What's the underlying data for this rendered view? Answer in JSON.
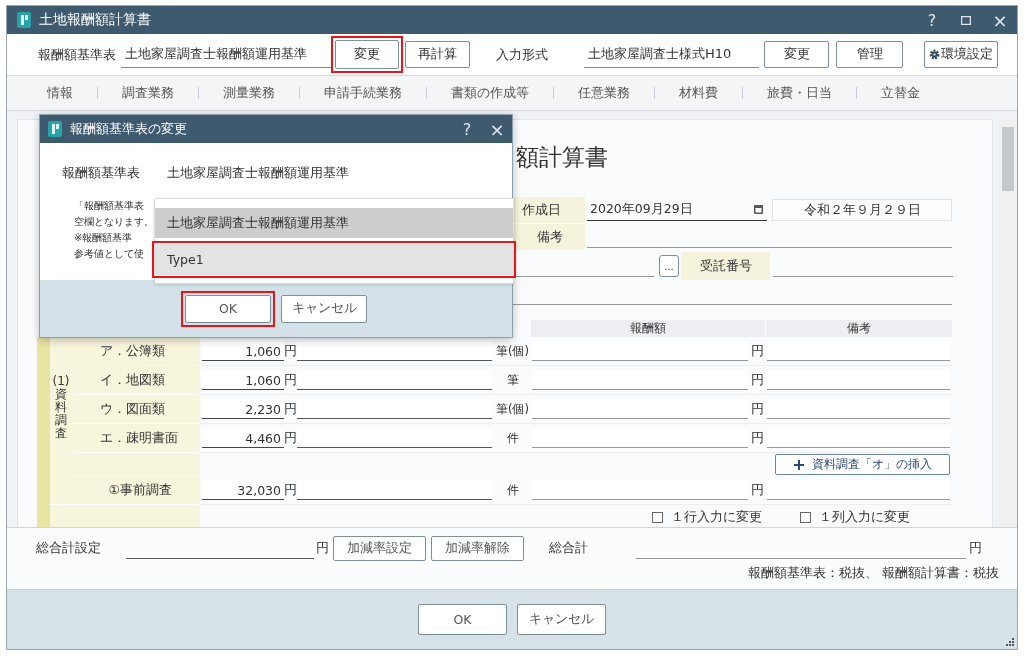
{
  "window": {
    "title": "土地報酬額計算書",
    "help": "?",
    "close": "×"
  },
  "toolbar": {
    "fee_table_label": "報酬額基準表",
    "fee_table_value": "土地家屋調査士報酬額運用基準",
    "fee_buttons": [
      {
        "label": "変更",
        "highlighted": true
      },
      {
        "label": "再計算",
        "highlighted": false
      }
    ],
    "format_label": "入力形式",
    "format_value": "土地家屋調査士様式H10",
    "format_buttons": [
      {
        "label": "変更",
        "highlighted": false
      },
      {
        "label": "管理",
        "highlighted": false
      }
    ],
    "settings_button": "環境設定"
  },
  "tabs": [
    {
      "label": "情報"
    },
    {
      "label": "調査業務"
    },
    {
      "label": "測量業務"
    },
    {
      "label": "申請手続業務"
    },
    {
      "label": "書類の作成等"
    },
    {
      "label": "任意業務"
    },
    {
      "label": "材料費"
    },
    {
      "label": "旅費・日当"
    },
    {
      "label": "立替金"
    }
  ],
  "document": {
    "title": "額計算書",
    "created_label": "作成日",
    "created_date": "2020年09月29日",
    "era_date": "令和２年９月２９日",
    "remarks_label": "備考",
    "browse_button": "...",
    "order_no_label": "受託番号",
    "table_headers": [
      "報酬額",
      "備考"
    ],
    "section_number": "(1)",
    "section_label": "資料調査",
    "rows": [
      {
        "label": "ア．公簿類",
        "amount": "1,060",
        "yen": "円",
        "unit": "筆(個)",
        "reward_yen": "円"
      },
      {
        "label": "イ．地図類",
        "amount": "1,060",
        "yen": "円",
        "unit": "筆",
        "reward_yen": "円"
      },
      {
        "label": "ウ．図面類",
        "amount": "2,230",
        "yen": "円",
        "unit": "筆(個)",
        "reward_yen": "円"
      },
      {
        "label": "エ．疎明書面",
        "amount": "4,460",
        "yen": "円",
        "unit": "件",
        "reward_yen": "円"
      }
    ],
    "insert_button": "資料調査「オ」の挿入",
    "pre_survey": {
      "label": "①事前調査",
      "amount": "32,030",
      "yen": "円",
      "unit": "件",
      "reward_yen": "円"
    },
    "checkboxes": [
      {
        "label": "１行入力に変更",
        "checked": false
      },
      {
        "label": "１列入力に変更",
        "checked": false
      }
    ]
  },
  "footer": {
    "total_setting_label": "総合計設定",
    "total_setting_yen": "円",
    "buttons": [
      "加減率設定",
      "加減率解除"
    ],
    "total_label": "総合計",
    "total_yen": "円",
    "note": "報酬額基準表：税抜、 報酬額計算書：税抜"
  },
  "bottom_buttons": [
    "OK",
    "キャンセル"
  ],
  "dialog": {
    "title": "報酬額基準表の変更",
    "help": "?",
    "close": "×",
    "field_label": "報酬額基準表",
    "field_value": "土地家屋調査士報酬額運用基準",
    "notes": [
      "「報酬額基準表",
      "空欄となります。",
      "※報酬額基準",
      "参考値として使"
    ],
    "options": [
      {
        "label": "土地家屋調査士報酬額運用基準",
        "selected": true,
        "highlighted": false
      },
      {
        "label": "Type1",
        "selected": false,
        "highlighted": true
      }
    ],
    "buttons": [
      {
        "label": "OK",
        "highlighted": true
      },
      {
        "label": "キャンセル",
        "highlighted": false
      }
    ]
  }
}
